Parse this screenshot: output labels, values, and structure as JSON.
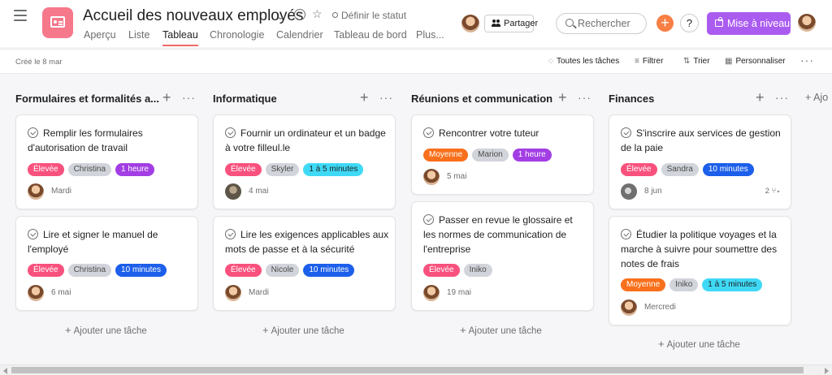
{
  "project": {
    "title": "Accueil des nouveaux employés",
    "set_status": "Définir le statut",
    "tabs": [
      "Aperçu",
      "Liste",
      "Tableau",
      "Chronologie",
      "Calendrier",
      "Tableau de bord",
      "Plus..."
    ],
    "active_tab": "Tableau",
    "icon": "project-board-icon",
    "icon_color": "#f6788b"
  },
  "header": {
    "share_label": "Partager",
    "search_placeholder": "Rechercher",
    "help_label": "?",
    "upgrade_label": "Mise à niveau",
    "upgrade_color": "#ab5cf0",
    "add_color": "#f97f44"
  },
  "toolbar": {
    "created": "Créé le 8 mar",
    "all_tasks": "Toutes les tâches",
    "filter": "Filtrer",
    "sort": "Trier",
    "customize": "Personnaliser"
  },
  "board": {
    "add_section": "+ Ajo",
    "add_task_label": "Ajouter une tâche",
    "columns": [
      {
        "title": "Formulaires et formalités a...",
        "cards": [
          {
            "title": "Remplir les formulaires d'autorisation de travail",
            "tags": [
              "Élevée",
              "Christina",
              "1 heure"
            ],
            "date": "Mardi"
          },
          {
            "title": "Lire et signer le manuel de l'employé",
            "tags": [
              "Élevée",
              "Christina",
              "10 minutes"
            ],
            "date": "6 mai"
          }
        ]
      },
      {
        "title": "Informatique",
        "cards": [
          {
            "title": "Fournir un ordinateur et un badge à votre filleul.le",
            "tags": [
              "Élevée",
              "Skyler",
              "1 à 5 minutes"
            ],
            "date": "4 mai"
          },
          {
            "title": "Lire les exigences applicables aux mots de passe et à la sécurité",
            "tags": [
              "Élevée",
              "Nicole",
              "10 minutes"
            ],
            "date": "Mardi"
          }
        ]
      },
      {
        "title": "Réunions et communication",
        "cards": [
          {
            "title": "Rencontrer votre tuteur",
            "tags": [
              "Moyenne",
              "Marion",
              "1 heure"
            ],
            "date": "5 mai"
          },
          {
            "title": "Passer en revue le glossaire et les normes de communication de l'entreprise",
            "tags": [
              "Élevée",
              "Iniko"
            ],
            "date": "19 mai"
          }
        ]
      },
      {
        "title": "Finances",
        "cards": [
          {
            "title": "S'inscrire aux services de gestion de la paie",
            "tags": [
              "Élevée",
              "Sandra",
              "10 minutes"
            ],
            "date": "8 jun",
            "subtasks": "2"
          },
          {
            "title": "Étudier la politique voyages et la marche à suivre pour soumettre des notes de frais",
            "tags": [
              "Moyenne",
              "Iniko",
              "1 à 5 minutes"
            ],
            "date": "Mercredi"
          }
        ]
      }
    ]
  },
  "tag_colors": {
    "Élevée": "#f9517d",
    "Moyenne": "#f9701c",
    "person": "#d2d4db",
    "1 heure": "#a23ee3",
    "10 minutes": "#1c5fea",
    "1 à 5 minutes": "#3fd9f6"
  }
}
